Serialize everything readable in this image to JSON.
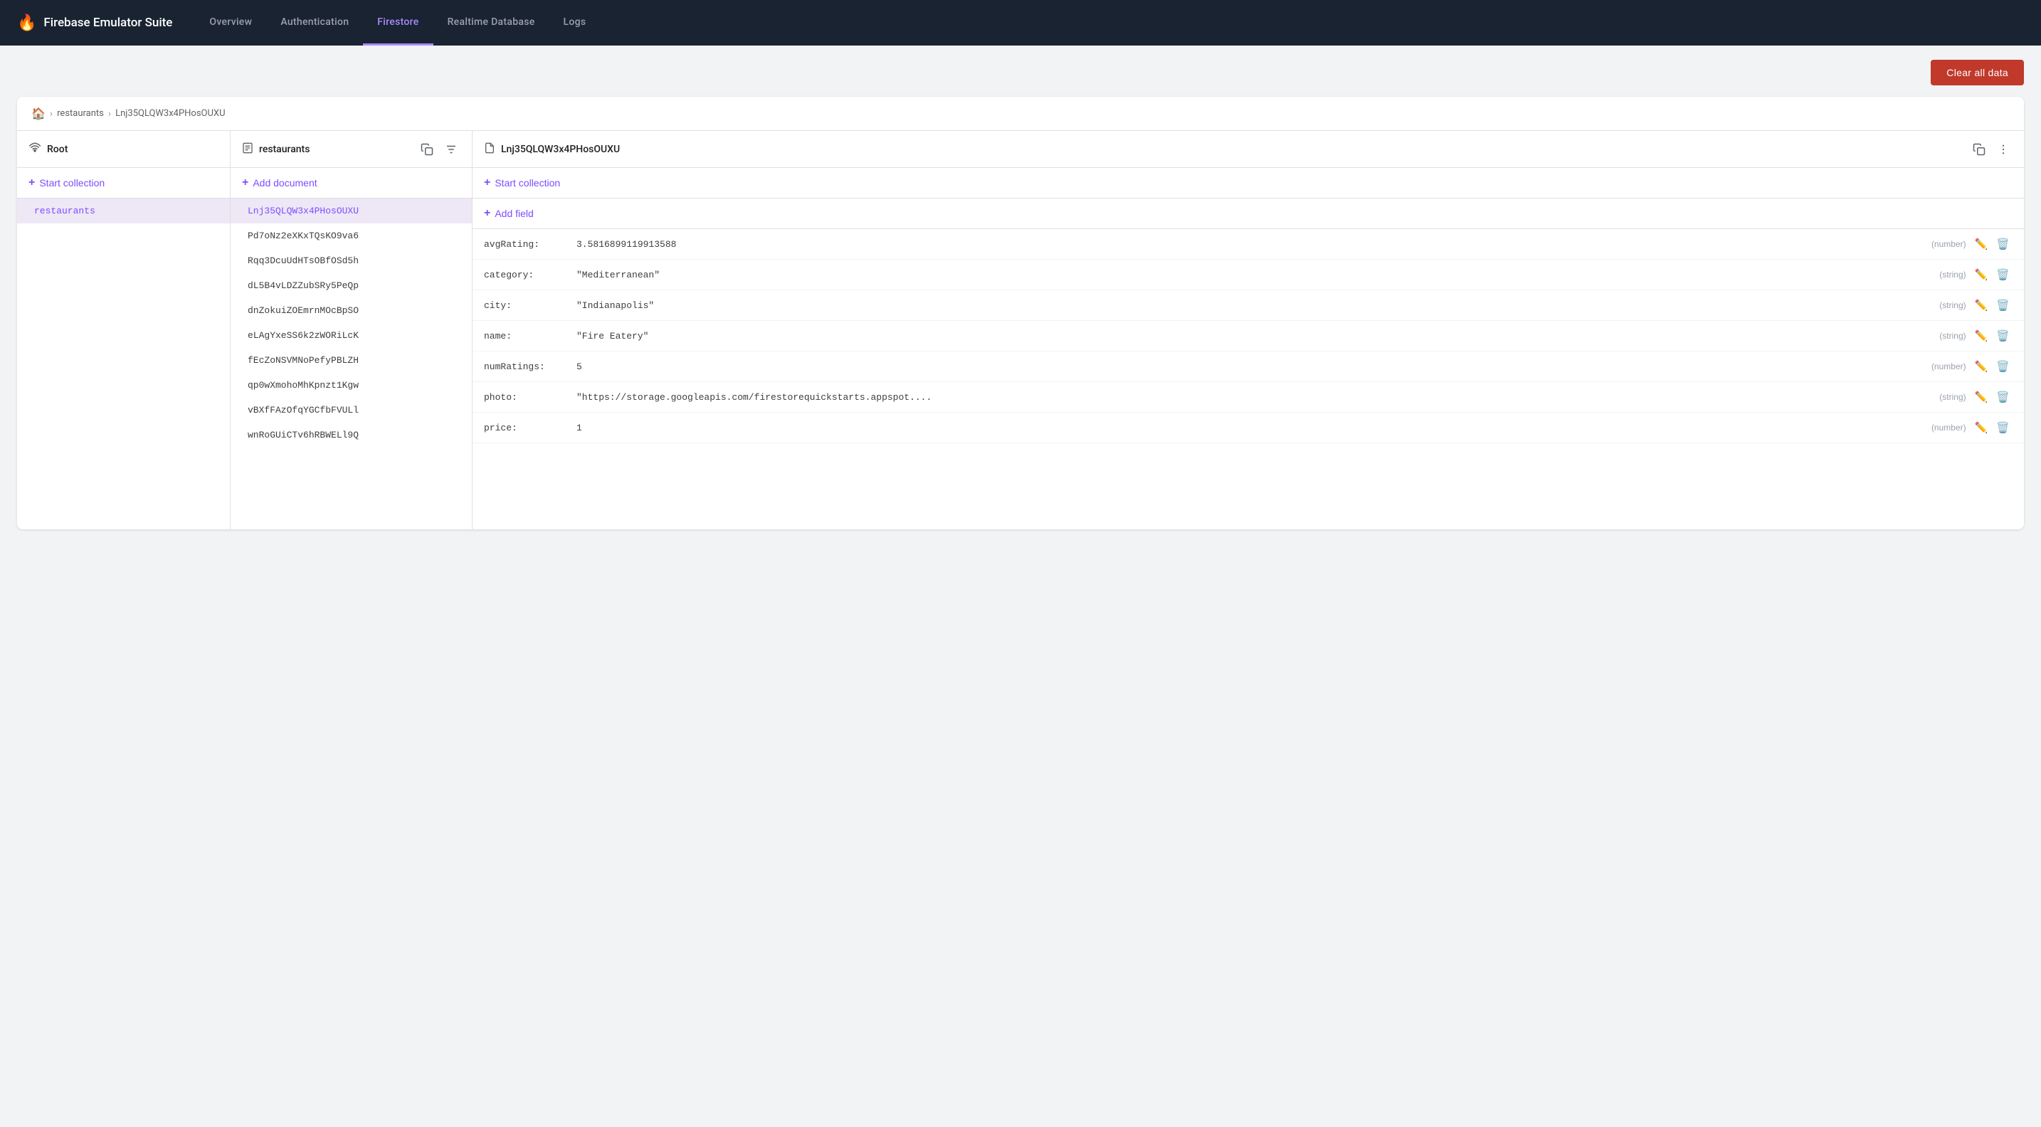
{
  "app": {
    "title": "Firebase Emulator Suite",
    "flame": "🔥"
  },
  "nav": {
    "links": [
      {
        "id": "overview",
        "label": "Overview",
        "active": false
      },
      {
        "id": "authentication",
        "label": "Authentication",
        "active": false
      },
      {
        "id": "firestore",
        "label": "Firestore",
        "active": true
      },
      {
        "id": "realtime-database",
        "label": "Realtime Database",
        "active": false
      },
      {
        "id": "logs",
        "label": "Logs",
        "active": false
      }
    ]
  },
  "toolbar": {
    "clear_all_label": "Clear all data"
  },
  "breadcrumb": {
    "home_icon": "⌂",
    "separator": "›",
    "items": [
      "restaurants",
      "Lnj35QLQW3x4PHosOUXU"
    ]
  },
  "columns": {
    "root": {
      "title": "Root",
      "start_collection_label": "Start collection",
      "items": [
        {
          "id": "restaurants",
          "label": "restaurants",
          "selected": true
        }
      ]
    },
    "collection": {
      "title": "restaurants",
      "add_document_label": "Add document",
      "items": [
        {
          "id": "lnj35",
          "label": "Lnj35QLQW3x4PHosOUXU",
          "selected": true
        },
        {
          "id": "pd7",
          "label": "Pd7oNz2eXKxTQsKO9va6",
          "selected": false
        },
        {
          "id": "rqq3",
          "label": "Rqq3DcuUdHTsOBfOSd5h",
          "selected": false
        },
        {
          "id": "dl5b",
          "label": "dL5B4vLDZZubSRy5PeQp",
          "selected": false
        },
        {
          "id": "dnzo",
          "label": "dnZokuiZOEmrnMOcBpSO",
          "selected": false
        },
        {
          "id": "elag",
          "label": "eLAgYxeSS6k2zWORiLcK",
          "selected": false
        },
        {
          "id": "fecz",
          "label": "fEcZoNSVMNoPefyPBLZH",
          "selected": false
        },
        {
          "id": "qp0w",
          "label": "qp0wXmohoMhKpnzt1Kgw",
          "selected": false
        },
        {
          "id": "vbxf",
          "label": "vBXfFAzOfqYGCfbFVULl",
          "selected": false
        },
        {
          "id": "wnro",
          "label": "wnRoGUiCTv6hRBWELl9Q",
          "selected": false
        }
      ]
    },
    "document": {
      "title": "Lnj35QLQW3x4PHosOUXU",
      "start_collection_label": "Start collection",
      "add_field_label": "Add field",
      "fields": [
        {
          "key": "avgRating:",
          "value": "3.5816899119913588",
          "type": "(number)"
        },
        {
          "key": "category:",
          "value": "\"Mediterranean\"",
          "type": "(string)"
        },
        {
          "key": "city:",
          "value": "\"Indianapolis\"",
          "type": "(string)"
        },
        {
          "key": "name:",
          "value": "\"Fire Eatery\"",
          "type": "(string)"
        },
        {
          "key": "numRatings:",
          "value": "5",
          "type": "(number)"
        },
        {
          "key": "photo:",
          "value": "\"https://storage.googleapis.com/firestorequickstarts.appspot....",
          "type": "(string)"
        },
        {
          "key": "price:",
          "value": "1",
          "type": "(number)"
        }
      ]
    }
  }
}
